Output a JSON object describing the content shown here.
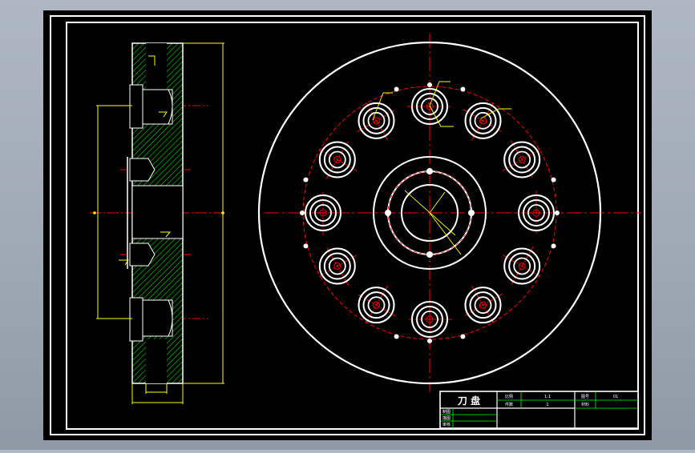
{
  "title_block": {
    "title": "刀 盘",
    "scale_label": "比例",
    "scale_value": "1:1",
    "sheet_label": "图号",
    "sheet_value": "01",
    "qty_label": "件数",
    "qty_value": "1",
    "material_label": "材料",
    "rows": [
      "制图",
      "描图",
      "审核"
    ]
  },
  "colors": {
    "background": "#000000",
    "frame": "#ffffff",
    "center_line": "#ff0000",
    "dimension": "#ffff00",
    "hatch": "#00ff00"
  },
  "icons": {
    "cutter_hole": "concentric-rings-icon",
    "small_hole": "dot-icon"
  }
}
